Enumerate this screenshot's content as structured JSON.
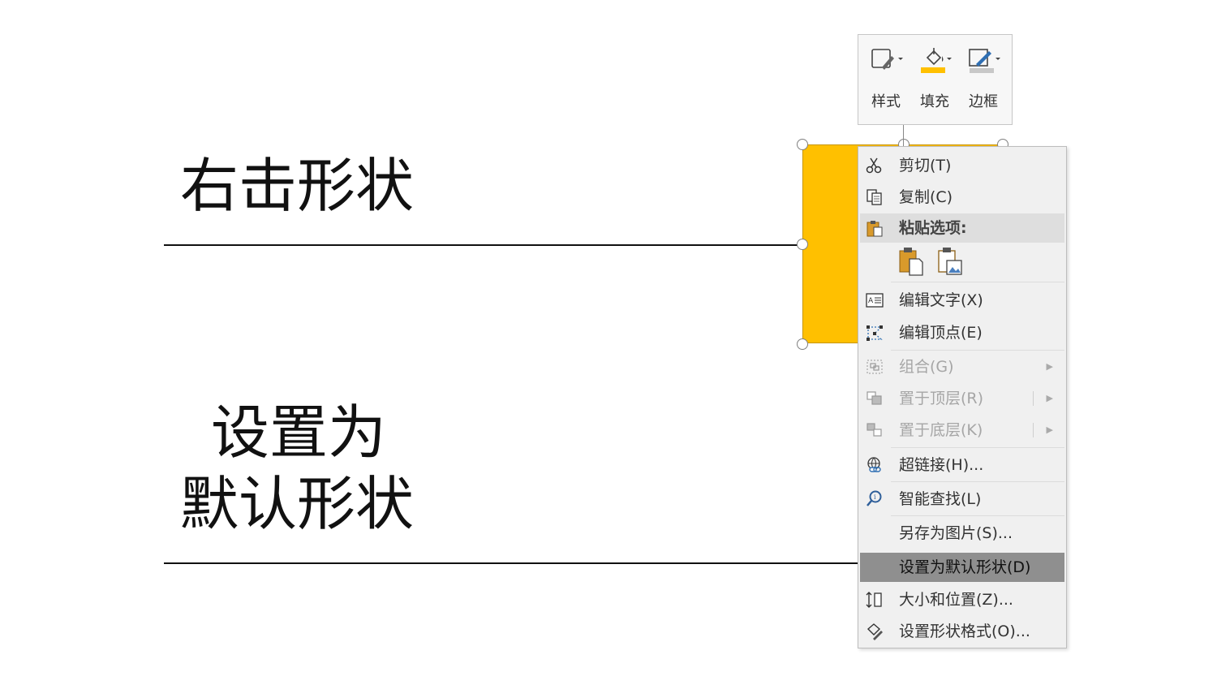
{
  "slide": {
    "text_right_click": "右击形状",
    "text_set_as_line1": "设置为",
    "text_set_as_line2": "默认形状"
  },
  "colors": {
    "shape_fill": "#FFC000",
    "menu_bg": "#F0F0F0",
    "highlight_bg": "#8F8F8F"
  },
  "mini_toolbar": {
    "style_label": "样式",
    "fill_label": "填充",
    "border_label": "边框"
  },
  "context_menu": {
    "cut": "剪切(T)",
    "copy": "复制(C)",
    "paste_options": "粘贴选项:",
    "edit_text": "编辑文字(X)",
    "edit_points": "编辑顶点(E)",
    "group": "组合(G)",
    "bring_to_front": "置于顶层(R)",
    "send_to_back": "置于底层(K)",
    "hyperlink": "超链接(H)...",
    "smart_lookup": "智能查找(L)",
    "save_as_picture": "另存为图片(S)...",
    "set_default_shape": "设置为默认形状(D)",
    "size_position": "大小和位置(Z)...",
    "format_shape": "设置形状格式(O)..."
  }
}
